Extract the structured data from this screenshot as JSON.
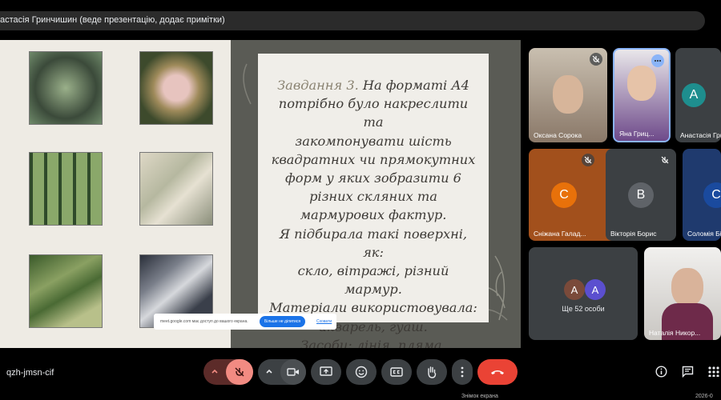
{
  "top_bar": {
    "presenter_text": "астасія Гринчишин (веде презентацію, додає примітки)"
  },
  "slide": {
    "highlight": "Завдання 3.",
    "lines": [
      " На форматі А4",
      "потрібно було накреслити та",
      "закомпонувати шість",
      "квадратних чи прямокутних",
      "форм у яких зобразити 6",
      "різних скляних та",
      "мармурових фактур.",
      "Я підбирала такі поверхні, як:",
      "скло, вітражі, різний мармур.",
      "Матеріали використовувала:",
      "акварель, гуаш.",
      "Засоби: лінія, пляма,"
    ]
  },
  "share_banner": {
    "message": "meet.google.com має доступ до вашого екрана.",
    "stop_button": "Більше не ділитися",
    "hide_link": "Сховати"
  },
  "participants": [
    {
      "name": "Оксана Сорока",
      "muted": true
    },
    {
      "name": "Яна Гриц...",
      "speaking": true
    },
    {
      "name": "Анастасія Гри",
      "initial": "А",
      "color": "#1e8e8e"
    },
    {
      "name": "Сніжана Галад...",
      "initial": "С",
      "color": "#e8710a",
      "muted": true
    },
    {
      "name": "Вікторія Борис",
      "initial": "В",
      "color": "#5f6368",
      "muted": true
    },
    {
      "name": "Соломія Бі",
      "initial": "С",
      "color": "#1a4a9e"
    },
    {
      "name": "Наталія Никор..."
    }
  ],
  "others": {
    "label": "Ще 52 особи",
    "initials": [
      "А",
      "А"
    ],
    "colors": [
      "#7a4a3a",
      "#5b4fcf"
    ]
  },
  "meeting_code": "qzh-jmsn-cif",
  "colors": {
    "end_call": "#ea4335",
    "mic_off_bg": "#f28b82"
  },
  "taskbar": {
    "text": "Знімок екрана",
    "date": "2026-0"
  }
}
